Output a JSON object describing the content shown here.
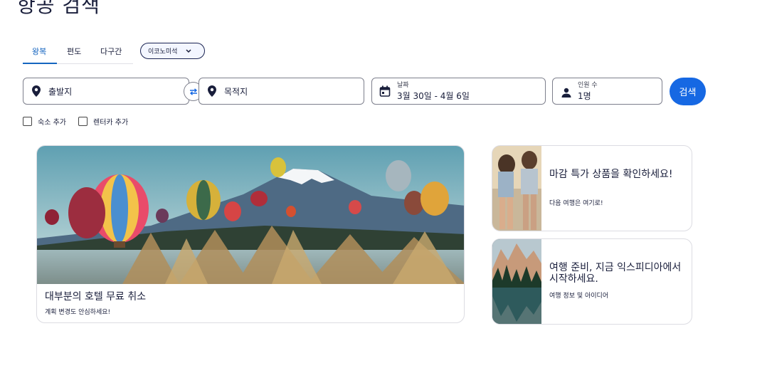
{
  "page": {
    "title": "항공 검색"
  },
  "tabs": [
    {
      "label": "왕복",
      "active": true
    },
    {
      "label": "편도",
      "active": false
    },
    {
      "label": "다구간",
      "active": false
    }
  ],
  "cabin_class": {
    "label": "이코노미석"
  },
  "search": {
    "origin_placeholder": "출발지",
    "destination_placeholder": "목적지",
    "dates_label": "날짜",
    "dates_value": "3월 30일 - 4월 6일",
    "travelers_label": "인원 수",
    "travelers_value": "1명",
    "search_button": "검색"
  },
  "options": [
    {
      "label": "숙소 추가",
      "checked": false
    },
    {
      "label": "렌터카 추가",
      "checked": false
    }
  ],
  "promos": {
    "main": {
      "title": "대부분의 호텔 무료 취소",
      "subtitle": "계획 변경도 안심하세요!"
    },
    "side1": {
      "title": "마감 특가 상품을 확인하세요!",
      "subtitle": "다음 여행은 여기로!"
    },
    "side2": {
      "title": "여행 준비, 지금 익스피디아에서 시작하세요.",
      "subtitle": "여행 정보 및 아이디어"
    }
  },
  "colors": {
    "accent": "#1668e3",
    "tab_active": "#1565c0",
    "text": "#191e3b"
  }
}
